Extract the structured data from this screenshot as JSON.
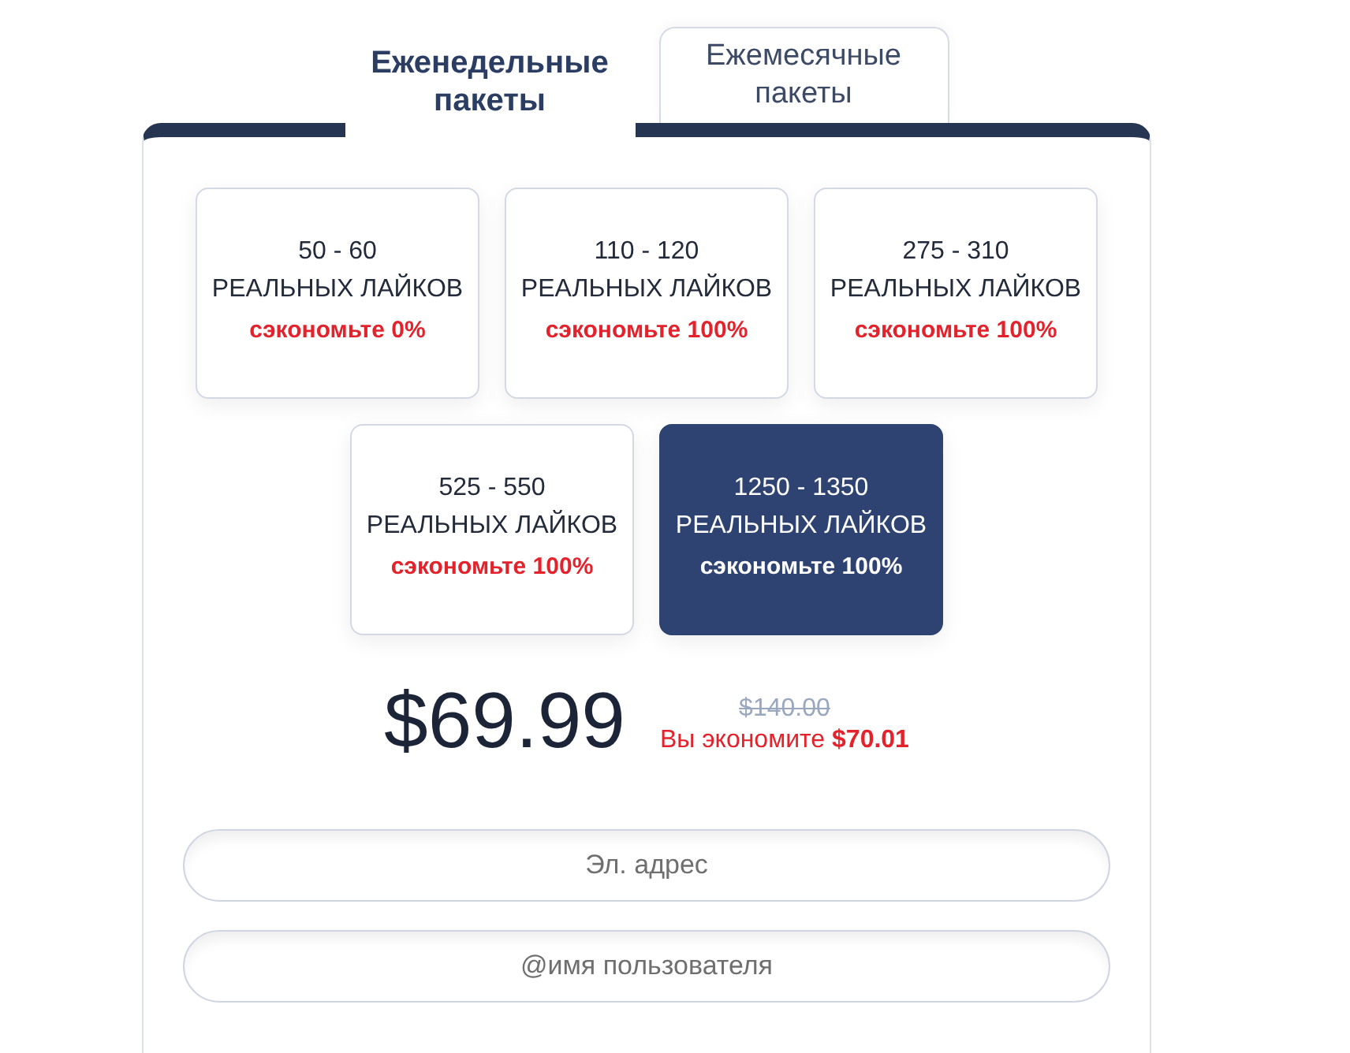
{
  "tabs": [
    {
      "label": "Еженедельные пакеты",
      "selected": true
    },
    {
      "label": "Ежемесячные пакеты",
      "selected": false
    }
  ],
  "packages": [
    {
      "range": "50 - 60",
      "unit": "РЕАЛЬНЫХ ЛАЙКОВ",
      "savings": "сэкономьте 0%",
      "selected": false
    },
    {
      "range": "110 - 120",
      "unit": "РЕАЛЬНЫХ ЛАЙКОВ",
      "savings": "сэкономьте 100%",
      "selected": false
    },
    {
      "range": "275 - 310",
      "unit": "РЕАЛЬНЫХ ЛАЙКОВ",
      "savings": "сэкономьте 100%",
      "selected": false
    },
    {
      "range": "525 - 550",
      "unit": "РЕАЛЬНЫХ ЛАЙКОВ",
      "savings": "сэкономьте 100%",
      "selected": false
    },
    {
      "range": "1250 - 1350",
      "unit": "РЕАЛЬНЫХ ЛАЙКОВ",
      "savings": "сэкономьте 100%",
      "selected": true
    }
  ],
  "price": {
    "current": "$69.99",
    "old": "$140.00",
    "savings": "Вы экономите **$70.01**"
  },
  "form": {
    "fields": [
      {
        "placeholder": "Эл. адрес"
      },
      {
        "placeholder": "@имя пользователя"
      }
    ]
  }
}
